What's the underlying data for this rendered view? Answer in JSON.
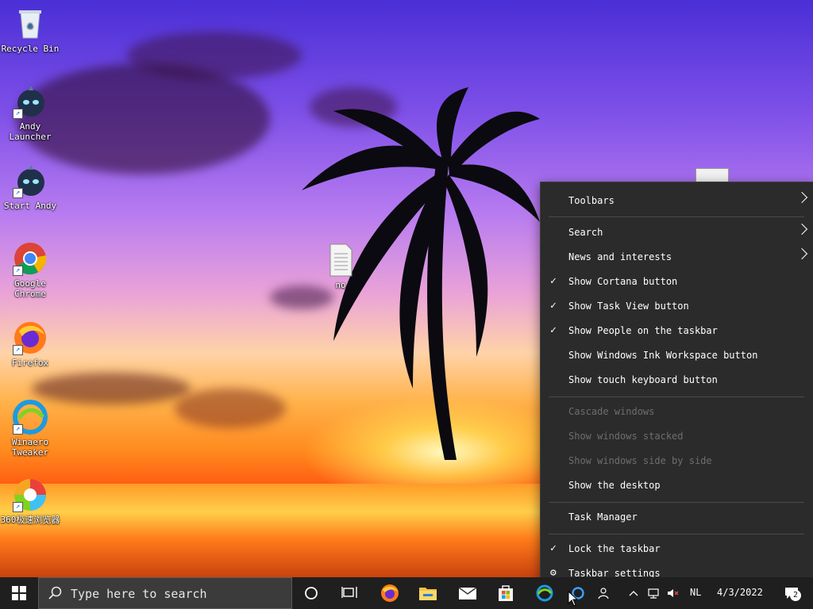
{
  "desktop": {
    "icons": [
      {
        "label": "Recycle Bin"
      },
      {
        "label": "Andy Launcher"
      },
      {
        "label": "Start Andy"
      },
      {
        "label": "Google Chrome"
      },
      {
        "label": "Firefox"
      },
      {
        "label": "Winaero Tweaker"
      },
      {
        "label": "360极速浏览器"
      },
      {
        "label": "no"
      }
    ]
  },
  "context_menu": {
    "items": [
      {
        "label": "Toolbars",
        "checked": false,
        "submenu": true
      },
      {
        "label": "Search",
        "checked": false,
        "submenu": true
      },
      {
        "label": "News and interests",
        "checked": false,
        "submenu": true
      },
      {
        "label": "Show Cortana button",
        "checked": true
      },
      {
        "label": "Show Task View button",
        "checked": true
      },
      {
        "label": "Show People on the taskbar",
        "checked": true
      },
      {
        "label": "Show Windows Ink Workspace button",
        "checked": false
      },
      {
        "label": "Show touch keyboard button",
        "checked": false
      },
      {
        "label": "Cascade windows",
        "disabled": true
      },
      {
        "label": "Show windows stacked",
        "disabled": true
      },
      {
        "label": "Show windows side by side",
        "disabled": true
      },
      {
        "label": "Show the desktop"
      },
      {
        "label": "Task Manager"
      },
      {
        "label": "Lock the taskbar",
        "checked": true
      },
      {
        "label": "Taskbar settings",
        "icon": "gear-icon"
      }
    ]
  },
  "taskbar": {
    "search_placeholder": "Type here to search",
    "language": "NL",
    "date": "4/3/2022",
    "notification_count": "2"
  },
  "colors": {
    "menu_bg": "#2b2b2b",
    "taskbar_bg": "#1f1f1f",
    "disabled_text": "#6e6e6e"
  }
}
